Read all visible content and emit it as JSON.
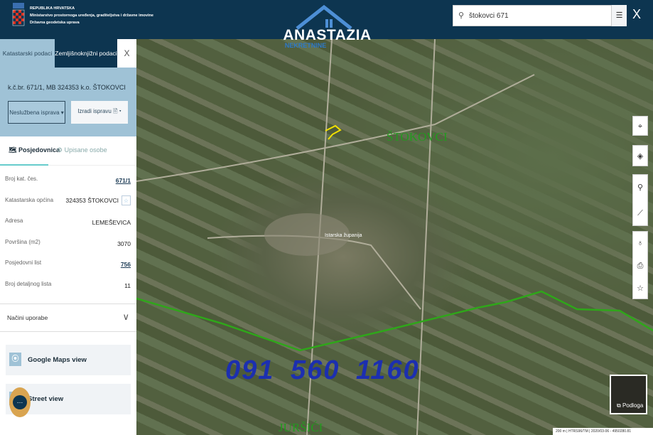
{
  "header": {
    "gov_lines": [
      "REPUBLIKA HRVATSKA",
      "Ministarstvo prostornoga uređenja, graditeljstva i državne imovine",
      "Državna geodetska uprava"
    ],
    "search_value": "štokovci 671",
    "close": "X"
  },
  "watermark": {
    "name": "ANASTAZIA",
    "sub": "NEKRETNINE",
    "phone": "091 560 1160"
  },
  "panel": {
    "tabs": [
      "Katastarski podaci",
      "Zemljišnoknjižni podaci",
      "X"
    ],
    "title": "k.č.br. 671/1, MB 324353 k.o. ŠTOKOVCI",
    "btn_unofficial": "Neslužbena isprava ▾",
    "btn_make": "Izradi ispravu 🖹 ▾",
    "subtabs": [
      "Posjedovnica",
      "Upisane osobe"
    ],
    "rows": [
      {
        "label": "Broj kat. čes.",
        "value": "671/1"
      },
      {
        "label": "Katastarska općina",
        "value": "324353 ŠTOKOVCI"
      },
      {
        "label": "Adresa",
        "value": "LEMEŠEVICA"
      },
      {
        "label": "Površina (m2)",
        "value": "3070"
      },
      {
        "label": "Posjedovni list",
        "value": "756"
      },
      {
        "label": "Broj detaljnog lista",
        "value": "11"
      }
    ],
    "nacini": "Načini uporabe",
    "google": "Google Maps view",
    "street": "Street view"
  },
  "map": {
    "place1": "ŠTOKOVCI",
    "place2": "Istarska županija",
    "place3": "JURŠIĆI",
    "podloga": "Podloga",
    "scale": "200 m",
    "crs": "HTRS96/TM | 2020/03-06 - 4950280.81"
  }
}
